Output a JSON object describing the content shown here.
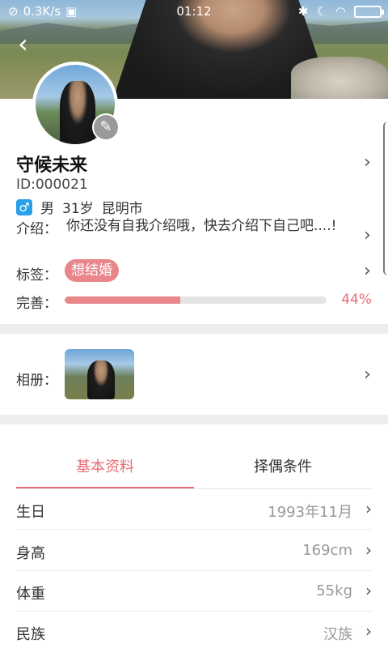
{
  "status_bar": {
    "speed": "0.3K/s",
    "time": "01:12"
  },
  "profile": {
    "name": "守候未来",
    "id_text": "ID:000021",
    "gender_symbol": "♂",
    "gender": "男",
    "age": "31岁",
    "city": "昆明市",
    "intro_label": "介绍：",
    "intro_text": "你还没有自我介绍哦，快去介绍下自己吧....!",
    "tags_label": "标签：",
    "tag": "想结婚",
    "completion_label": "完善：",
    "completion_percent": "44%",
    "completion_fraction": 0.44
  },
  "album": {
    "label": "相册："
  },
  "tabs": [
    {
      "label": "基本资料",
      "active": true
    },
    {
      "label": "择偶条件",
      "active": false
    }
  ],
  "details": [
    {
      "label": "生日",
      "value": "1993年11月"
    },
    {
      "label": "身高",
      "value": "169cm"
    },
    {
      "label": "体重",
      "value": "55kg"
    },
    {
      "label": "民族",
      "value": "汉族"
    }
  ],
  "colors": {
    "accent": "#e86d74",
    "tag_bg": "#e8868a",
    "gender_blue": "#26a0e8"
  },
  "icons": {
    "back": "back-arrow-icon",
    "edit": "edit-icon",
    "chevron": "chevron-right-icon"
  }
}
